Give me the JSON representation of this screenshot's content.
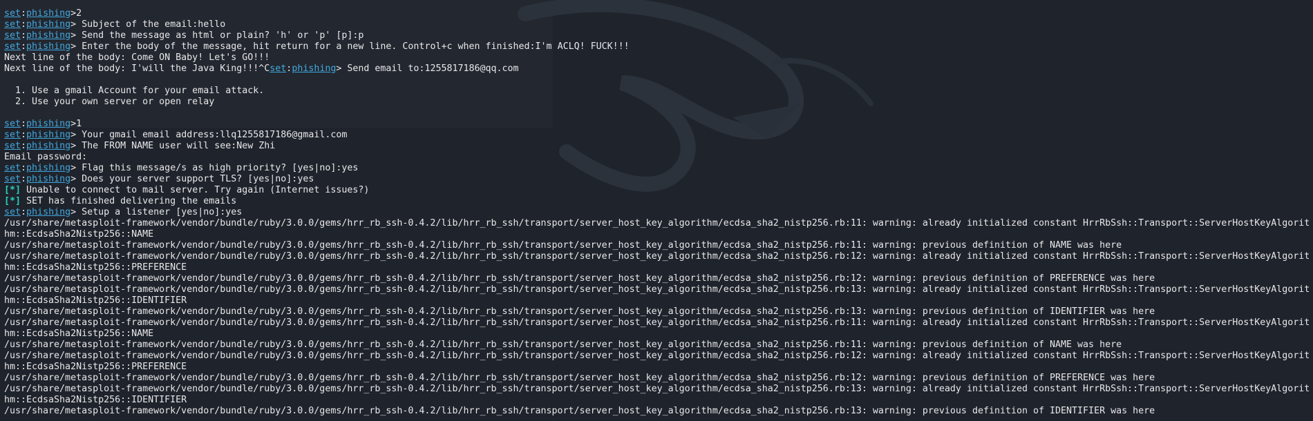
{
  "terminal": {
    "colors": {
      "background": "#1f232b",
      "text": "#e7e8ea",
      "prompt_link": "#41a8e0",
      "status_star": "#28d3c3"
    },
    "background_art": "kali-dragon-watermark",
    "lines": [
      [
        {
          "t": "set",
          "c": "link"
        },
        {
          "t": ":"
        },
        {
          "t": "phishing",
          "c": "link"
        },
        {
          "t": ">2"
        }
      ],
      [
        {
          "t": "set",
          "c": "link"
        },
        {
          "t": ":"
        },
        {
          "t": "phishing",
          "c": "link"
        },
        {
          "t": "> Subject of the email:hello"
        }
      ],
      [
        {
          "t": "set",
          "c": "link"
        },
        {
          "t": ":"
        },
        {
          "t": "phishing",
          "c": "link"
        },
        {
          "t": "> Send the message as html or plain? 'h' or 'p' [p]:p"
        }
      ],
      [
        {
          "t": "set",
          "c": "link"
        },
        {
          "t": ":"
        },
        {
          "t": "phishing",
          "c": "link"
        },
        {
          "t": "> Enter the body of the message, hit return for a new line. Control+c when finished:I'm ACLQ! FUCK!!!"
        }
      ],
      [
        {
          "t": "Next line of the body: Come ON Baby! Let's GO!!!"
        }
      ],
      [
        {
          "t": "Next line of the body: I'will the Java King!!!^C"
        },
        {
          "t": "set",
          "c": "link"
        },
        {
          "t": ":"
        },
        {
          "t": "phishing",
          "c": "link"
        },
        {
          "t": "> Send email to:1255817186@qq.com"
        }
      ],
      [
        {
          "t": ""
        }
      ],
      [
        {
          "t": "  1. Use a gmail Account for your email attack."
        }
      ],
      [
        {
          "t": "  2. Use your own server or open relay"
        }
      ],
      [
        {
          "t": ""
        }
      ],
      [
        {
          "t": "set",
          "c": "link"
        },
        {
          "t": ":"
        },
        {
          "t": "phishing",
          "c": "link"
        },
        {
          "t": ">1"
        }
      ],
      [
        {
          "t": "set",
          "c": "link"
        },
        {
          "t": ":"
        },
        {
          "t": "phishing",
          "c": "link"
        },
        {
          "t": "> Your gmail email address:llq1255817186@gmail.com"
        }
      ],
      [
        {
          "t": "set",
          "c": "link"
        },
        {
          "t": ":"
        },
        {
          "t": "phishing",
          "c": "link"
        },
        {
          "t": "> The FROM NAME user will see:New Zhi"
        }
      ],
      [
        {
          "t": "Email password:"
        }
      ],
      [
        {
          "t": "set",
          "c": "link"
        },
        {
          "t": ":"
        },
        {
          "t": "phishing",
          "c": "link"
        },
        {
          "t": "> Flag this message/s as high priority? [yes|no]:yes"
        }
      ],
      [
        {
          "t": "set",
          "c": "link"
        },
        {
          "t": ":"
        },
        {
          "t": "phishing",
          "c": "link"
        },
        {
          "t": "> Does your server support TLS? [yes|no]:yes"
        }
      ],
      [
        {
          "t": "[*]",
          "c": "star"
        },
        {
          "t": " Unable to connect to mail server. Try again (Internet issues?)"
        }
      ],
      [
        {
          "t": "[*]",
          "c": "star"
        },
        {
          "t": " SET has finished delivering the emails"
        }
      ],
      [
        {
          "t": "set",
          "c": "link"
        },
        {
          "t": ":"
        },
        {
          "t": "phishing",
          "c": "link"
        },
        {
          "t": "> Setup a listener [yes|no]:yes"
        }
      ],
      [
        {
          "t": "/usr/share/metasploit-framework/vendor/bundle/ruby/3.0.0/gems/hrr_rb_ssh-0.4.2/lib/hrr_rb_ssh/transport/server_host_key_algorithm/ecdsa_sha2_nistp256.rb:11: warning: already initialized constant HrrRbSsh::Transport::ServerHostKeyAlgorit"
        }
      ],
      [
        {
          "t": "hm::EcdsaSha2Nistp256::NAME"
        }
      ],
      [
        {
          "t": "/usr/share/metasploit-framework/vendor/bundle/ruby/3.0.0/gems/hrr_rb_ssh-0.4.2/lib/hrr_rb_ssh/transport/server_host_key_algorithm/ecdsa_sha2_nistp256.rb:11: warning: previous definition of NAME was here"
        }
      ],
      [
        {
          "t": "/usr/share/metasploit-framework/vendor/bundle/ruby/3.0.0/gems/hrr_rb_ssh-0.4.2/lib/hrr_rb_ssh/transport/server_host_key_algorithm/ecdsa_sha2_nistp256.rb:12: warning: already initialized constant HrrRbSsh::Transport::ServerHostKeyAlgorit"
        }
      ],
      [
        {
          "t": "hm::EcdsaSha2Nistp256::PREFERENCE"
        }
      ],
      [
        {
          "t": "/usr/share/metasploit-framework/vendor/bundle/ruby/3.0.0/gems/hrr_rb_ssh-0.4.2/lib/hrr_rb_ssh/transport/server_host_key_algorithm/ecdsa_sha2_nistp256.rb:12: warning: previous definition of PREFERENCE was here"
        }
      ],
      [
        {
          "t": "/usr/share/metasploit-framework/vendor/bundle/ruby/3.0.0/gems/hrr_rb_ssh-0.4.2/lib/hrr_rb_ssh/transport/server_host_key_algorithm/ecdsa_sha2_nistp256.rb:13: warning: already initialized constant HrrRbSsh::Transport::ServerHostKeyAlgorit"
        }
      ],
      [
        {
          "t": "hm::EcdsaSha2Nistp256::IDENTIFIER"
        }
      ],
      [
        {
          "t": "/usr/share/metasploit-framework/vendor/bundle/ruby/3.0.0/gems/hrr_rb_ssh-0.4.2/lib/hrr_rb_ssh/transport/server_host_key_algorithm/ecdsa_sha2_nistp256.rb:13: warning: previous definition of IDENTIFIER was here"
        }
      ],
      [
        {
          "t": "/usr/share/metasploit-framework/vendor/bundle/ruby/3.0.0/gems/hrr_rb_ssh-0.4.2/lib/hrr_rb_ssh/transport/server_host_key_algorithm/ecdsa_sha2_nistp256.rb:11: warning: already initialized constant HrrRbSsh::Transport::ServerHostKeyAlgorit"
        }
      ],
      [
        {
          "t": "hm::EcdsaSha2Nistp256::NAME"
        }
      ],
      [
        {
          "t": "/usr/share/metasploit-framework/vendor/bundle/ruby/3.0.0/gems/hrr_rb_ssh-0.4.2/lib/hrr_rb_ssh/transport/server_host_key_algorithm/ecdsa_sha2_nistp256.rb:11: warning: previous definition of NAME was here"
        }
      ],
      [
        {
          "t": "/usr/share/metasploit-framework/vendor/bundle/ruby/3.0.0/gems/hrr_rb_ssh-0.4.2/lib/hrr_rb_ssh/transport/server_host_key_algorithm/ecdsa_sha2_nistp256.rb:12: warning: already initialized constant HrrRbSsh::Transport::ServerHostKeyAlgorit"
        }
      ],
      [
        {
          "t": "hm::EcdsaSha2Nistp256::PREFERENCE"
        }
      ],
      [
        {
          "t": "/usr/share/metasploit-framework/vendor/bundle/ruby/3.0.0/gems/hrr_rb_ssh-0.4.2/lib/hrr_rb_ssh/transport/server_host_key_algorithm/ecdsa_sha2_nistp256.rb:12: warning: previous definition of PREFERENCE was here"
        }
      ],
      [
        {
          "t": "/usr/share/metasploit-framework/vendor/bundle/ruby/3.0.0/gems/hrr_rb_ssh-0.4.2/lib/hrr_rb_ssh/transport/server_host_key_algorithm/ecdsa_sha2_nistp256.rb:13: warning: already initialized constant HrrRbSsh::Transport::ServerHostKeyAlgorit"
        }
      ],
      [
        {
          "t": "hm::EcdsaSha2Nistp256::IDENTIFIER"
        }
      ],
      [
        {
          "t": "/usr/share/metasploit-framework/vendor/bundle/ruby/3.0.0/gems/hrr_rb_ssh-0.4.2/lib/hrr_rb_ssh/transport/server_host_key_algorithm/ecdsa_sha2_nistp256.rb:13: warning: previous definition of IDENTIFIER was here"
        }
      ]
    ]
  }
}
